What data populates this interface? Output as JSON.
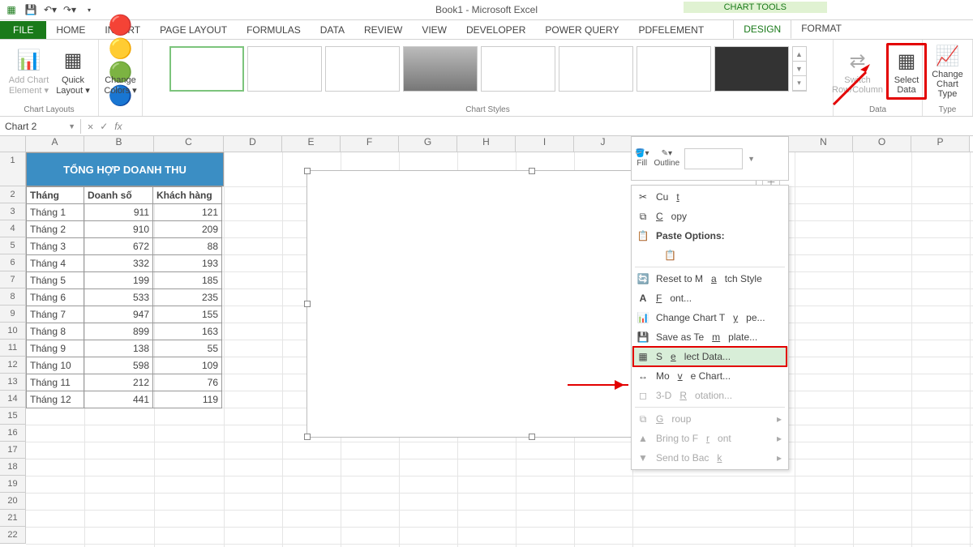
{
  "window": {
    "title": "Book1 - Microsoft Excel",
    "chart_tools": "CHART TOOLS"
  },
  "tabs": {
    "file": "FILE",
    "home": "HOME",
    "insert": "INSERT",
    "page_layout": "PAGE LAYOUT",
    "formulas": "FORMULAS",
    "data": "DATA",
    "review": "REVIEW",
    "view": "VIEW",
    "developer": "DEVELOPER",
    "power_query": "POWER QUERY",
    "pdf": "PDFelement",
    "design": "DESIGN",
    "format": "FORMAT"
  },
  "ribbon": {
    "add_element": "Add Chart Element",
    "quick_layout": "Quick Layout",
    "change_colors": "Change Colors",
    "switch": "Switch Row/Column",
    "select_data": "Select Data",
    "change_type": "Change Chart Type",
    "grp_layouts": "Chart Layouts",
    "grp_styles": "Chart Styles",
    "grp_data": "Data",
    "grp_type": "Type"
  },
  "namebox": {
    "value": "Chart 2"
  },
  "mini": {
    "fill": "Fill",
    "outline": "Outline"
  },
  "context_menu": {
    "cut": "Cut",
    "copy": "Copy",
    "paste_opts": "Paste Options:",
    "reset": "Reset to Match Style",
    "font": "Font...",
    "change_chart": "Change Chart Type...",
    "save_template": "Save as Template...",
    "select_data": "Select Data...",
    "move_chart": "Move Chart...",
    "rotation": "3-D Rotation...",
    "group": "Group",
    "bring_front": "Bring to Front",
    "send_back": "Send to Back"
  },
  "sheet": {
    "title": "TỔNG HỢP DOANH THU",
    "headers": {
      "a": "Tháng",
      "b": "Doanh số",
      "c": "Khách hàng"
    },
    "rows": [
      {
        "a": "Tháng 1",
        "b": "911",
        "c": "121"
      },
      {
        "a": "Tháng 2",
        "b": "910",
        "c": "209"
      },
      {
        "a": "Tháng 3",
        "b": "672",
        "c": "88"
      },
      {
        "a": "Tháng 4",
        "b": "332",
        "c": "193"
      },
      {
        "a": "Tháng 5",
        "b": "199",
        "c": "185"
      },
      {
        "a": "Tháng 6",
        "b": "533",
        "c": "235"
      },
      {
        "a": "Tháng 7",
        "b": "947",
        "c": "155"
      },
      {
        "a": "Tháng 8",
        "b": "899",
        "c": "163"
      },
      {
        "a": "Tháng 9",
        "b": "138",
        "c": "55"
      },
      {
        "a": "Tháng 10",
        "b": "598",
        "c": "109"
      },
      {
        "a": "Tháng 11",
        "b": "212",
        "c": "76"
      },
      {
        "a": "Tháng 12",
        "b": "441",
        "c": "119"
      }
    ]
  },
  "columns": [
    "A",
    "B",
    "C",
    "D",
    "E",
    "F",
    "G",
    "H",
    "I",
    "J",
    "N",
    "O",
    "P"
  ]
}
